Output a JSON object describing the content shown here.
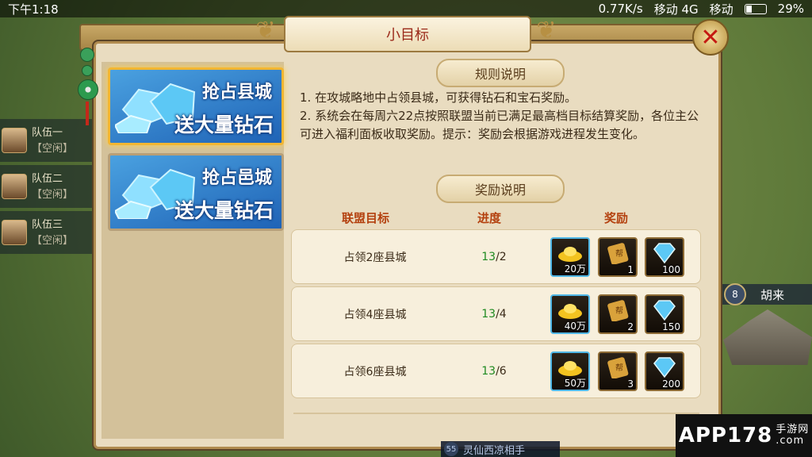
{
  "status_bar": {
    "time": "下午1:18",
    "speed": "0.77K/s",
    "carrier1": "移动 4G",
    "carrier2": "移动",
    "battery": "29%"
  },
  "squads": [
    {
      "name": "队伍一",
      "state": "【空闲】"
    },
    {
      "name": "队伍二",
      "state": "【空闲】"
    },
    {
      "name": "队伍三",
      "state": "【空闲】"
    }
  ],
  "dialog": {
    "title": "小目标",
    "close_icon": "close-x-icon"
  },
  "tabs": [
    {
      "line1": "抢占县城",
      "line2": "送大量钻石",
      "active": true
    },
    {
      "line1": "抢占邑城",
      "line2": "送大量钻石",
      "active": false
    }
  ],
  "rules": {
    "header": "规则说明",
    "items": [
      "1. 在攻城略地中占领县城，可获得钻石和宝石奖励。",
      "2. 系统会在每周六22点按照联盟当前已满足最高档目标结算奖励，各位主公可进入福利面板收取奖励。提示：奖励会根据游戏进程发生变化。"
    ]
  },
  "rewards": {
    "header": "奖励说明",
    "columns": {
      "goal": "联盟目标",
      "progress": "进度",
      "reward": "奖励"
    },
    "rows": [
      {
        "goal": "占领2座县城",
        "progress_current": "13",
        "progress_target": "/2",
        "items": [
          {
            "icon": "gold-ingot-icon",
            "qty": "20万"
          },
          {
            "icon": "scroll-icon",
            "qty": "1"
          },
          {
            "icon": "diamond-icon",
            "qty": "100"
          }
        ]
      },
      {
        "goal": "占领4座县城",
        "progress_current": "13",
        "progress_target": "/4",
        "items": [
          {
            "icon": "gold-ingot-icon",
            "qty": "40万"
          },
          {
            "icon": "scroll-icon",
            "qty": "2"
          },
          {
            "icon": "diamond-icon",
            "qty": "150"
          }
        ]
      },
      {
        "goal": "占领6座县城",
        "progress_current": "13",
        "progress_target": "/6",
        "items": [
          {
            "icon": "gold-ingot-icon",
            "qty": "50万"
          },
          {
            "icon": "scroll-icon",
            "qty": "3"
          },
          {
            "icon": "diamond-icon",
            "qty": "200"
          }
        ]
      }
    ]
  },
  "map": {
    "city_level": "8",
    "city_name": "胡来",
    "bottom_level": "55",
    "bottom_text": "灵仙西凉相手"
  },
  "watermark": {
    "main": "APP178",
    "sub1": "手游网",
    "sub2": ".com"
  },
  "colors": {
    "title": "#9b2a1a",
    "progress_green": "#1f8a20",
    "column_header": "#b4410f"
  }
}
